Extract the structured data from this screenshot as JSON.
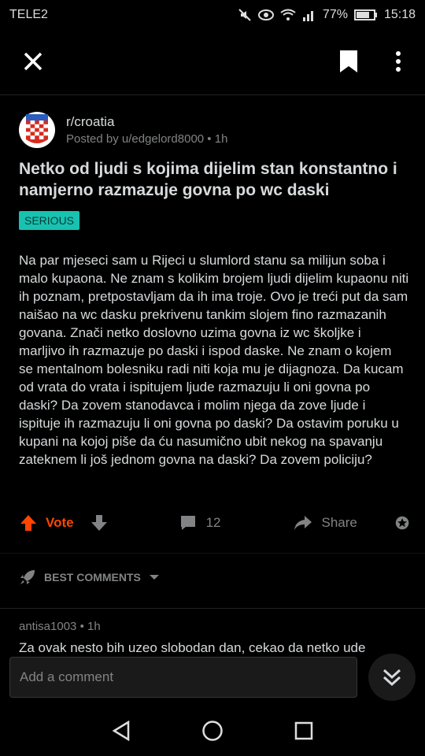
{
  "status": {
    "carrier": "TELE2",
    "battery": "77%",
    "time": "15:18"
  },
  "post": {
    "subreddit": "r/croatia",
    "posted_by": "Posted by u/edgelord8000 • 1h",
    "title": "Netko od ljudi s kojima dijelim stan konstantno i namjerno razmazuje govna po wc daski",
    "flair": "SERIOUS",
    "body": "Na par mjeseci sam u Rijeci u slumlord stanu sa milijun soba i malo kupaona. Ne znam s kolikim brojem ljudi dijelim kupaonu niti ih poznam, pretpostavljam da ih ima troje. Ovo je treći put da sam naišao na wc dasku prekrivenu tankim slojem fino razmazanih govana. Znači netko doslovno uzima govna iz wc školjke i marljivo ih razmazuje po daski i ispod daske. Ne znam o kojem se mentalnom bolesniku radi niti koja mu je dijagnoza. Da kucam od vrata do vrata i ispitujem ljude razmazuju li oni govna po daski? Da zovem stanodavca i molim njega da zove ljude i ispituje ih razmazuju li oni govna po daski? Da ostavim poruku u kupani na kojoj piše da ću nasumično ubit nekog na spavanju zateknem li još jednom govna na daski? Da zovem policiju?"
  },
  "actions": {
    "vote_label": "Vote",
    "comment_count": "12",
    "share_label": "Share"
  },
  "sort": {
    "label": "BEST COMMENTS"
  },
  "comment": {
    "meta": "antisa1003 • 1h",
    "text": "Za ovak nesto bih uzeo slobodan dan, cekao da netko ude"
  },
  "composer": {
    "placeholder": "Add a comment"
  },
  "colors": {
    "accent": "#ff4500",
    "flair_bg": "#17c2b1",
    "background": "#000000"
  }
}
